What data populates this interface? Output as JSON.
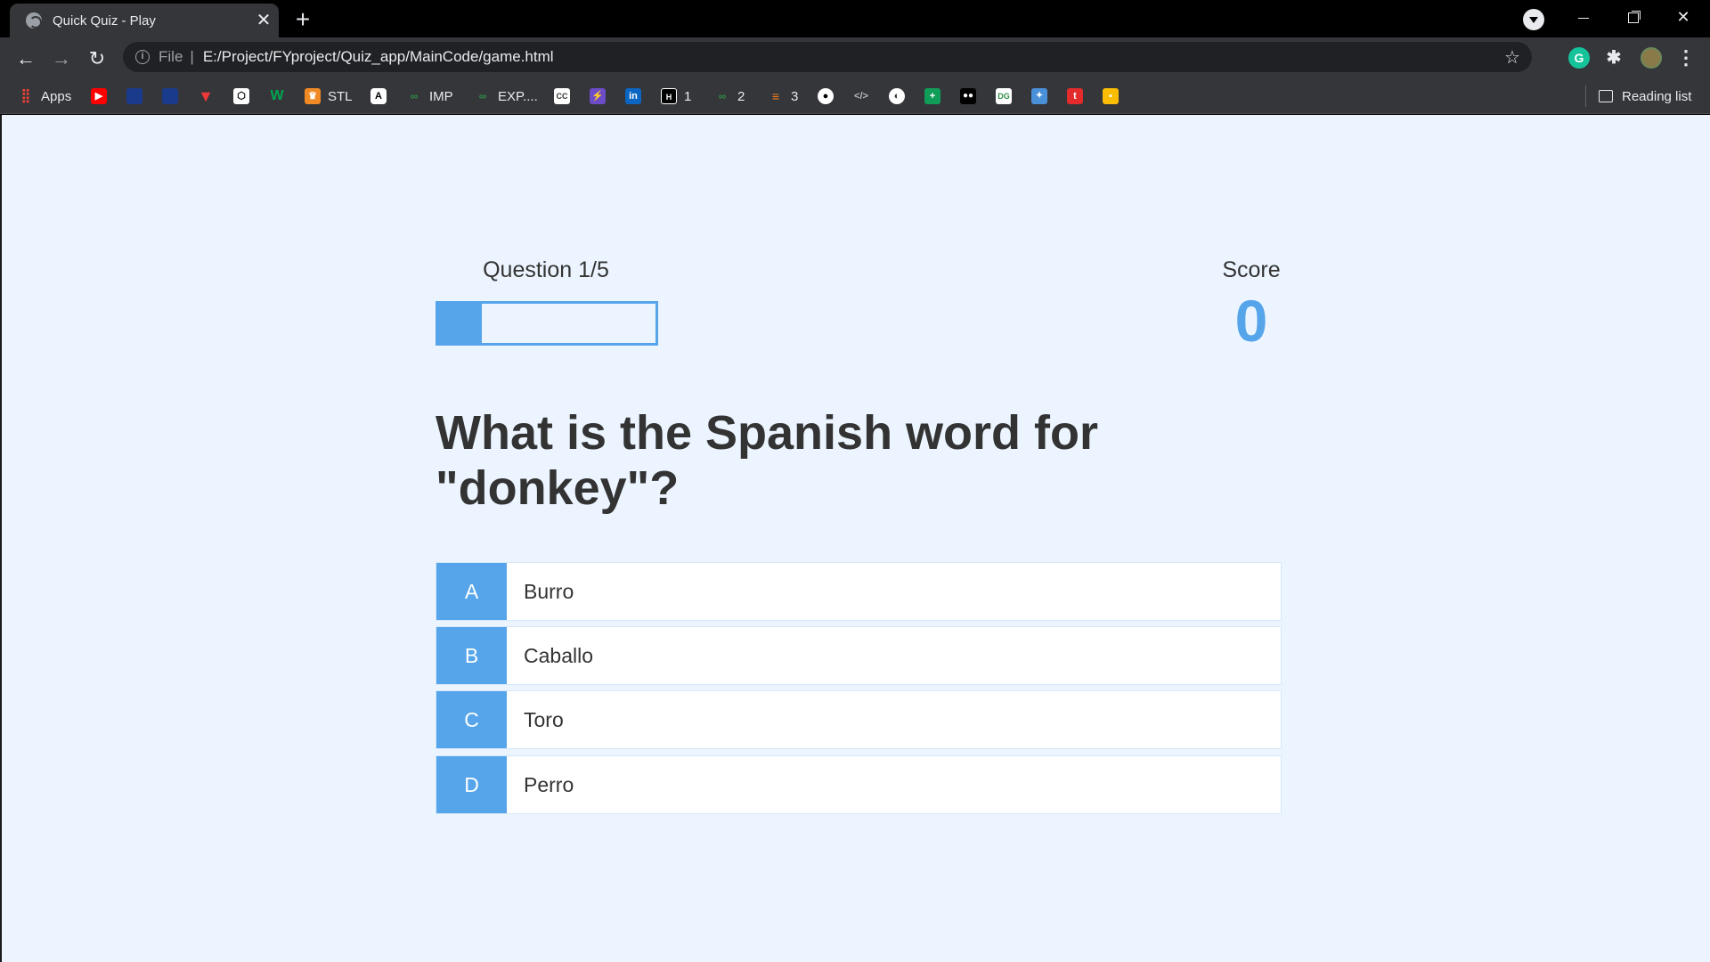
{
  "browser": {
    "tab_title": "Quick Quiz - Play",
    "url_scheme": "File",
    "url": "E:/Project/FYproject/Quiz_app/MainCode/game.html",
    "bookmarks": [
      {
        "label": "Apps",
        "icon": "apps-grid-icon"
      },
      {
        "label": "STL",
        "icon": "stl-icon"
      },
      {
        "label": "IMP",
        "icon": "gfg-icon"
      },
      {
        "label": "EXP....",
        "icon": "gfg-icon"
      },
      {
        "label": "1",
        "icon": "hackerrank-icon"
      },
      {
        "label": "2",
        "icon": "gfg-icon"
      },
      {
        "label": "3",
        "icon": "stackoverflow-icon"
      }
    ],
    "reading_list": "Reading list",
    "extension_g": "G"
  },
  "quiz": {
    "progress_text": "Question 1/5",
    "progress_fraction": 0.2,
    "score_label": "Score",
    "score_value": "0",
    "question": "What is the Spanish word for \"donkey\"?",
    "choices": [
      {
        "prefix": "A",
        "text": "Burro"
      },
      {
        "prefix": "B",
        "text": "Caballo"
      },
      {
        "prefix": "C",
        "text": "Toro"
      },
      {
        "prefix": "D",
        "text": "Perro"
      }
    ]
  },
  "colors": {
    "accent": "#56a5eb",
    "page_background": "#ecf5ff",
    "text": "#333333"
  }
}
